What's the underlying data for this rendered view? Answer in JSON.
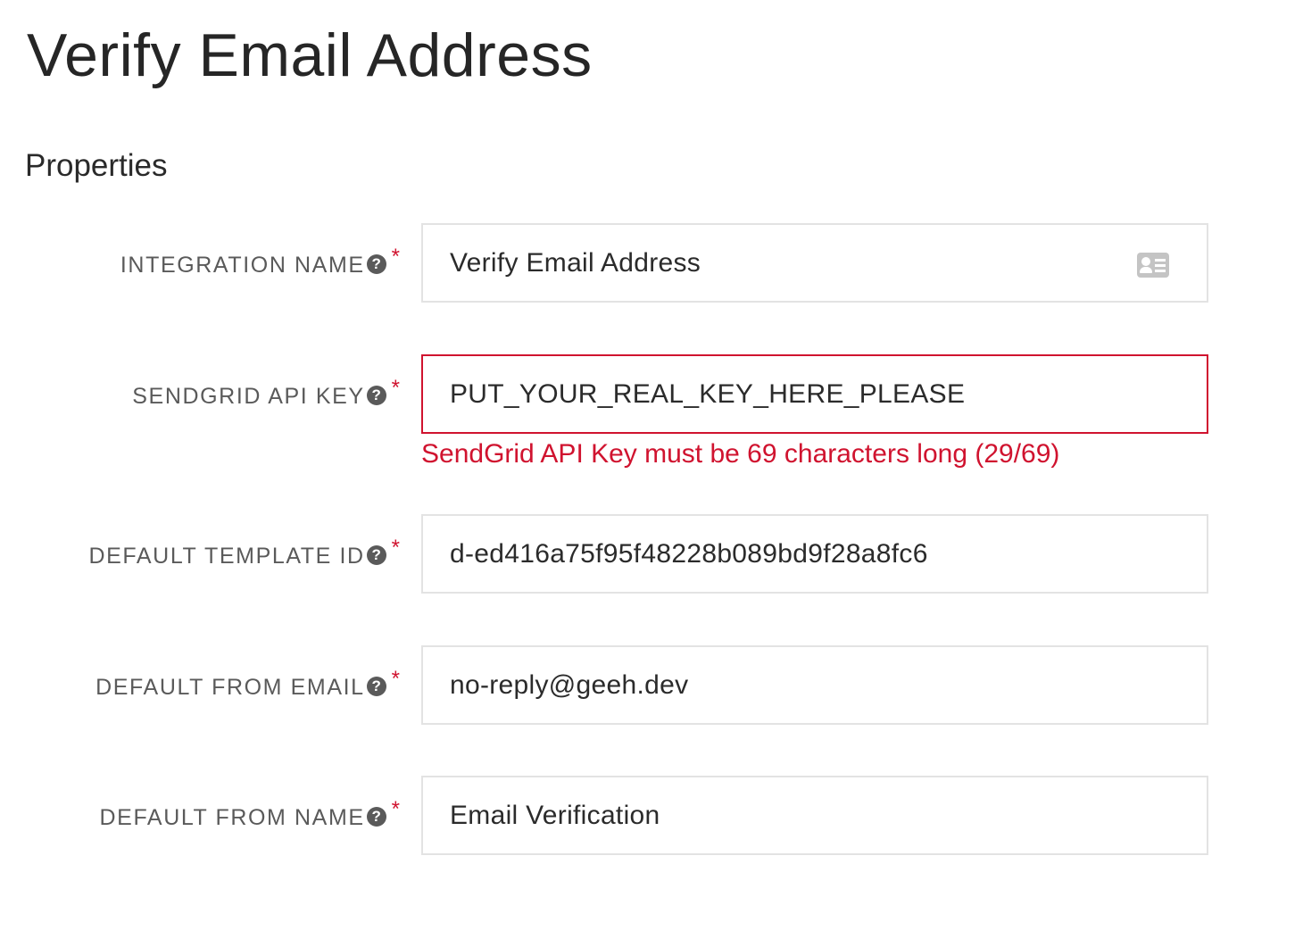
{
  "page": {
    "title": "Verify Email Address",
    "section_title": "Properties"
  },
  "fields": [
    {
      "label": "INTEGRATION NAME",
      "help_icon": "?",
      "required_mark": "*",
      "value": "Verify Email Address",
      "trailing_icon": "contact-card-icon"
    },
    {
      "label": "SENDGRID API KEY",
      "help_icon": "?",
      "required_mark": "*",
      "value": "PUT_YOUR_REAL_KEY_HERE_PLEASE",
      "error": "SendGrid API Key must be 69 characters long (29/69)"
    },
    {
      "label": "DEFAULT TEMPLATE ID",
      "help_icon": "?",
      "required_mark": "*",
      "value": "d-ed416a75f95f48228b089bd9f28a8fc6"
    },
    {
      "label": "DEFAULT FROM EMAIL",
      "help_icon": "?",
      "required_mark": "*",
      "value": "no-reply@geeh.dev"
    },
    {
      "label": "DEFAULT FROM NAME",
      "help_icon": "?",
      "required_mark": "*",
      "value": "Email Verification"
    }
  ],
  "colors": {
    "error": "#d0132f",
    "label": "#5a5a5a",
    "input_border": "#e3e3e3"
  }
}
